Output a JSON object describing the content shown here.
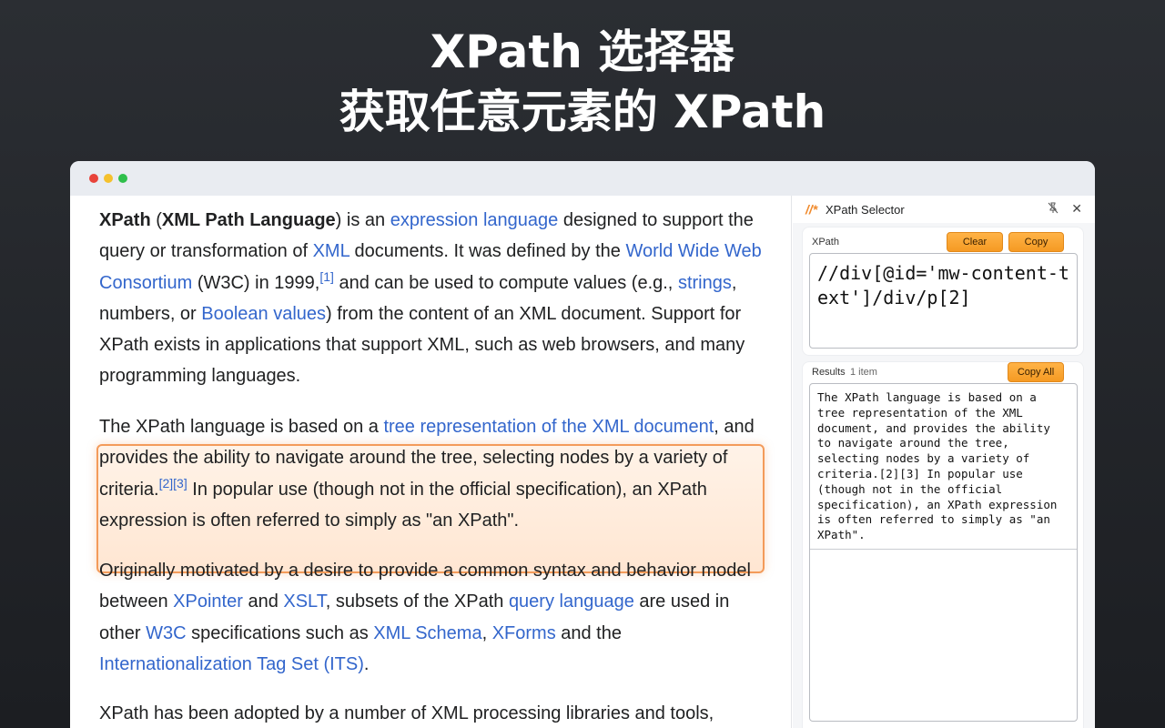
{
  "hero": {
    "line1": "XPath 选择器",
    "line2": "获取任意元素的 XPath"
  },
  "article": {
    "p1": {
      "t1": "XPath",
      "t2": " (",
      "t3": "XML Path Language",
      "t4": ") is an ",
      "l1": "expression language",
      "t5": " designed to support the query or transformation of ",
      "l2": "XML",
      "t6": " documents. It was defined by the ",
      "l3": "World Wide Web Consortium",
      "t7": " (W3C) in 1999,",
      "s1": "[1]",
      "t8": " and can be used to compute values (e.g., ",
      "l4": "strings",
      "t9": ", numbers, or ",
      "l5": "Boolean values",
      "t10": ") from the content of an XML document. Support for XPath exists in applications that support XML, such as web browsers, and many programming languages."
    },
    "p2": {
      "t1": "The XPath language is based on a ",
      "l1": "tree representation of the XML document",
      "t2": ", and provides the ability to navigate around the tree, selecting nodes by a variety of criteria.",
      "s1": "[2][3]",
      "t3": " In popular use (though not in the official specification), an XPath expression is often referred to simply as \"an XPath\"."
    },
    "p3": {
      "t1": "Originally motivated by a desire to provide a common syntax and behavior model between ",
      "l1": "XPointer",
      "t2": " and ",
      "l2": "XSLT",
      "t3": ", subsets of the XPath ",
      "l3": "query language",
      "t4": " are used in other ",
      "l4": "W3C",
      "t5": " specifications such as ",
      "l5": "XML Schema",
      "t6": ", ",
      "l6": "XForms",
      "t7": " and the ",
      "l7": "Internationalization Tag Set (ITS)",
      "t8": "."
    },
    "p4": {
      "t1": "XPath has been adopted by a number of XML processing libraries and tools,"
    }
  },
  "panel": {
    "logo": "//*",
    "title": "XPath Selector",
    "pin_icon": "pin-off-icon",
    "close_icon": "close-icon",
    "xpath_label": "XPath",
    "clear_label": "Clear",
    "copy_label": "Copy",
    "xpath_value": "//div[@id='mw-content-text']/div/p[2]",
    "results_label": "Results",
    "results_count": "1 item",
    "copy_all_label": "Copy All",
    "result_text": "The XPath language is based on a tree representation of the XML document, and provides the ability to navigate around the tree, selecting nodes by a variety of criteria.[2][3] In popular use (though not in the official specification), an XPath expression is often referred to simply as \"an XPath\"."
  },
  "colors": {
    "accent": "#f59a23",
    "link": "#3366cc",
    "highlight_border": "#f39b5a"
  }
}
